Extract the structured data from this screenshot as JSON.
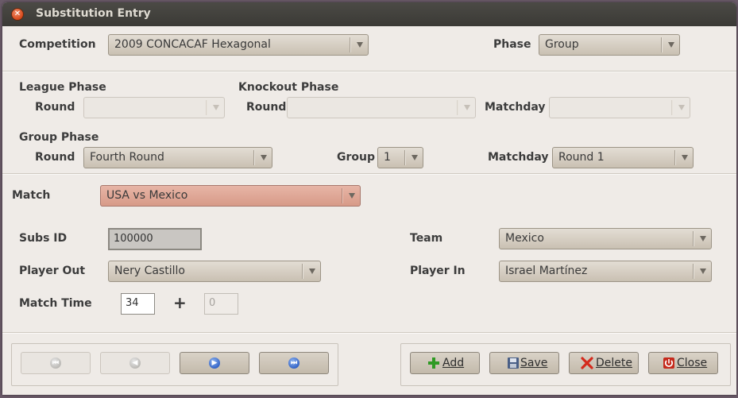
{
  "window": {
    "title": "Substitution Entry"
  },
  "competition": {
    "label": "Competition",
    "value": "2009 CONCACAF Hexagonal"
  },
  "phase": {
    "label": "Phase",
    "value": "Group"
  },
  "league_phase": {
    "heading": "League Phase",
    "round_label": "Round",
    "round_value": ""
  },
  "knockout_phase": {
    "heading": "Knockout Phase",
    "round_label": "Round",
    "round_value": "",
    "matchday_label": "Matchday",
    "matchday_value": ""
  },
  "group_phase": {
    "heading": "Group Phase",
    "round_label": "Round",
    "round_value": "Fourth Round",
    "group_label": "Group",
    "group_value": "1",
    "matchday_label": "Matchday",
    "matchday_value": "Round 1"
  },
  "match": {
    "label": "Match",
    "value": "USA vs Mexico"
  },
  "subs_id": {
    "label": "Subs ID",
    "value": "100000"
  },
  "team": {
    "label": "Team",
    "value": "Mexico"
  },
  "player_out": {
    "label": "Player Out",
    "value": "Nery Castillo"
  },
  "player_in": {
    "label": "Player In",
    "value": "Israel Martínez"
  },
  "match_time": {
    "label": "Match Time",
    "value": "34",
    "plus": "+",
    "extra": "0"
  },
  "buttons": {
    "add": "Add",
    "save": "Save",
    "delete": "Delete",
    "close": "Close"
  },
  "colors": {
    "match_highlight": "#dba594",
    "titlebar": "#3f3e3a",
    "window_bg": "#efebe7"
  }
}
